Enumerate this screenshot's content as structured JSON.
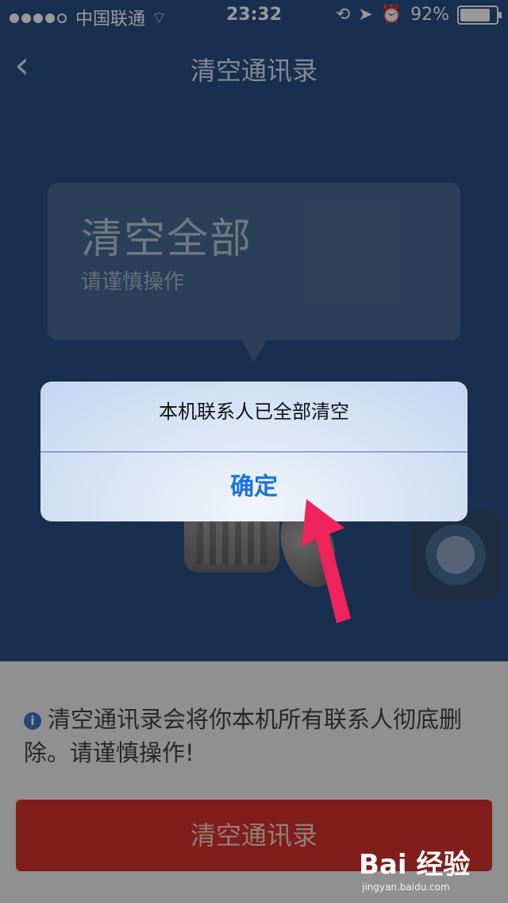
{
  "status_bar": {
    "carrier": "中国联通",
    "time": "23:32",
    "battery": "92%",
    "battery_level": 0.92
  },
  "nav": {
    "title": "清空通讯录"
  },
  "bubble": {
    "title": "清空全部",
    "subtitle": "请谨慎操作"
  },
  "notice": {
    "text": "清空通讯录会将你本机所有联系人彻底删除。请谨慎操作!"
  },
  "primary_button": {
    "label": "清空通讯录"
  },
  "alert": {
    "message": "本机联系人已全部清空",
    "ok_label": "确定"
  },
  "watermark": {
    "logo": "Bai 经验",
    "url": "jingyan.baidu.com"
  },
  "colors": {
    "app_blue": "#2a4f86",
    "danger_red": "#d8322d",
    "ios_blue": "#1a73d8",
    "arrow_pink": "#f0245c"
  }
}
